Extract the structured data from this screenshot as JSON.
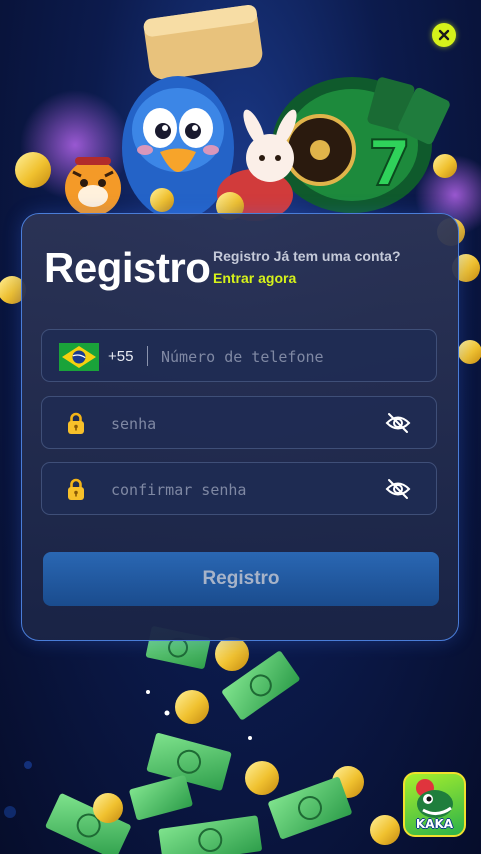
{
  "header": {
    "close_icon": "close-icon"
  },
  "form": {
    "title": "Registro",
    "login_prompt": "Registro Já tem uma conta?",
    "login_link": "Entrar agora",
    "phone": {
      "country": "Brasil",
      "flag_icon": "brazil-flag-icon",
      "prefix": "+55",
      "placeholder": "Número de telefone",
      "value": ""
    },
    "password": {
      "placeholder": "senha",
      "value": "",
      "lock_icon": "lock-icon",
      "toggle_icon": "eye-off-icon"
    },
    "confirm_password": {
      "placeholder": "confirmar senha",
      "value": "",
      "lock_icon": "lock-icon",
      "toggle_icon": "eye-off-icon"
    },
    "submit_label": "Registro"
  },
  "badge": {
    "label": "KAKA"
  },
  "colors": {
    "accent": "#d6f21a",
    "panel_border": "#4a7dd8",
    "button": "#1f5aa0",
    "background": "#0c1b4d"
  }
}
